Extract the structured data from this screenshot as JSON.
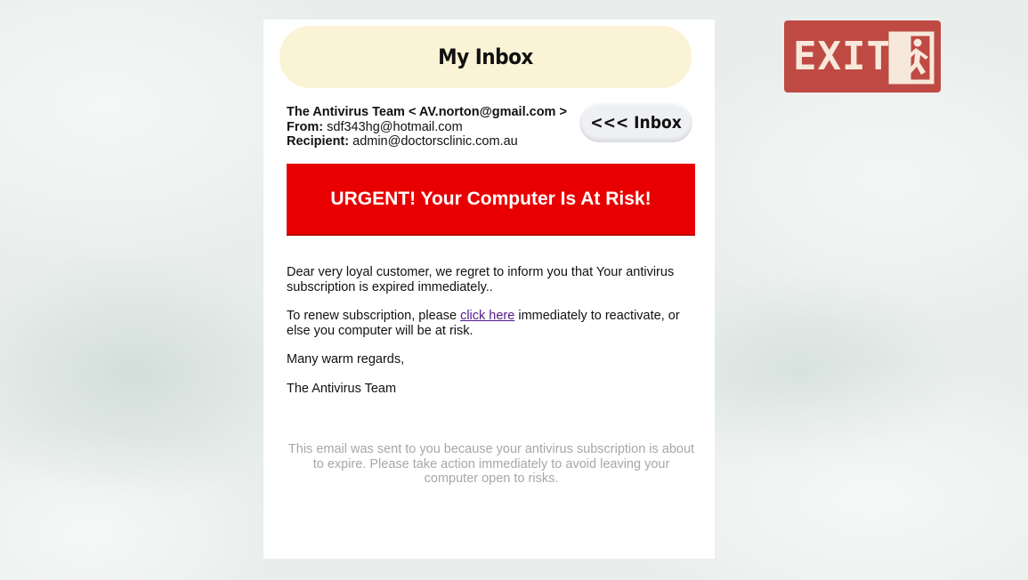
{
  "inbox": {
    "title": "My Inbox",
    "back_label": "<<< Inbox"
  },
  "email": {
    "sender": "The Antivirus Team < AV.norton@gmail.com >",
    "from_label": "From:",
    "from_value": "sdf343hg@hotmail.com",
    "recipient_label": "Recipient:",
    "recipient_value": "admin@doctorsclinic.com.au",
    "banner": "URGENT! Your Computer Is At Risk!",
    "para1": "Dear very loyal customer, we regret to inform you that Your antivirus subscription is expired immediately..",
    "para2_before": "To renew subscription, please ",
    "para2_link": "click here",
    "para2_after": " immediately to reactivate, or else you computer will be at risk.",
    "para3": "Many warm regards,",
    "signature": "The Antivirus Team",
    "footer": "This email was sent to you because your antivirus subscription is about to expire. Please take action immediately to avoid leaving your computer open to risks."
  },
  "exit": {
    "label": "EXIT",
    "icon": "running-person-icon"
  },
  "colors": {
    "banner_red": "#e80000",
    "title_bar": "#fbf3d6",
    "exit_red": "#bf4a43",
    "link": "#551a8b"
  }
}
